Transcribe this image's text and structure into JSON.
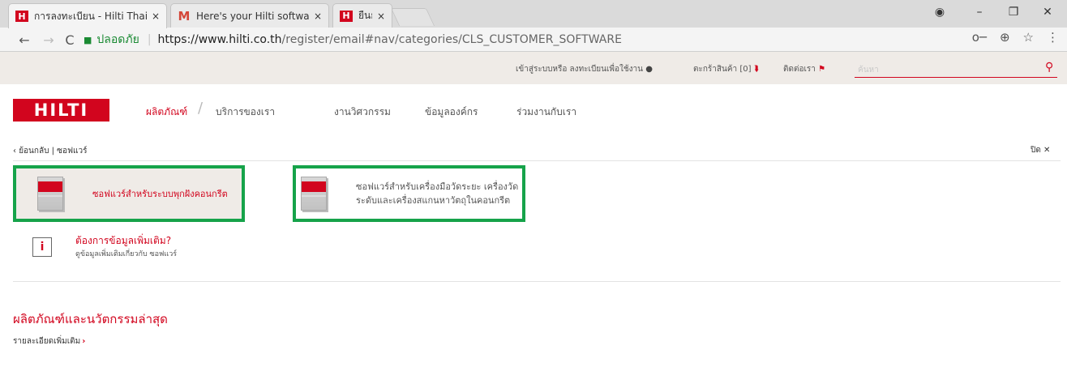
{
  "browser": {
    "tabs": [
      {
        "title": "การลงทะเบียน - Hilti Thailan",
        "favicon": "hilti",
        "active": true
      },
      {
        "title": "Here's your Hilti software",
        "favicon": "gmail",
        "active": false
      },
      {
        "title": "ยืนยันการสั่งซื้อ - Hilti Thail",
        "favicon": "hilti",
        "active": false
      }
    ],
    "tab_close_glyph": "×",
    "window_controls": {
      "profile": "◉",
      "minimize": "–",
      "restore": "❐",
      "close": "✕"
    },
    "nav": {
      "back": "←",
      "forward": "→",
      "reload": "C"
    },
    "secure_label": "ปลอดภัย",
    "url_host": "https://www.hilti.co.th",
    "url_path": "/register/email#nav/categories/CLS_CUSTOMER_SOFTWARE",
    "omnibox_icons": {
      "key": "o─",
      "zoom": "⊕",
      "star": "☆",
      "menu": "⋮"
    }
  },
  "utility": {
    "login_text": "เข้าสู่ระบบหรือ ลงทะเบียนเพื่อใช้งาน",
    "cart_text": "ตะกร้าสินค้า [0]",
    "contact_text": "ติดต่อเรา",
    "search_placeholder": "ค้นหา"
  },
  "logo_text": "HILTI",
  "nav_items": [
    {
      "label": "ผลิตภัณฑ์",
      "active": true
    },
    {
      "label": "บริการของเรา",
      "active": false
    },
    {
      "label": "งานวิศวกรรม",
      "active": false
    },
    {
      "label": "ข้อมูลองค์กร",
      "active": false
    },
    {
      "label": "ร่วมงานกับเรา",
      "active": false
    }
  ],
  "flyout": {
    "back_label": "ย้อนกลับ",
    "crumb_sep": "|",
    "crumb_current": "ซอฟแวร์",
    "close_label": "ปิด",
    "cards": [
      {
        "label_line1": "ซอฟแวร์สำหรับระบบพุกฝังคอนกรีต",
        "label_line2": ""
      },
      {
        "label_line1": "ซอฟแวร์สำหรับเครื่องมือวัดระยะ เครื่องวัด",
        "label_line2": "ระดับและเครื่องสแกนหาวัตถุในคอนกรีต"
      }
    ],
    "info_title": "ต้องการข้อมูลเพิ่มเติม?",
    "info_sub": "ดูข้อมูลเพิ่มเติมเกี่ยวกับ ซอฟแวร์"
  },
  "latest": {
    "title": "ผลิตภัณฑ์และนวัตกรรมล่าสุด",
    "more_label": "รายละเอียดเพิ่มเติม"
  },
  "colors": {
    "brand_red": "#d2051e",
    "highlight_green": "#16a34a"
  }
}
